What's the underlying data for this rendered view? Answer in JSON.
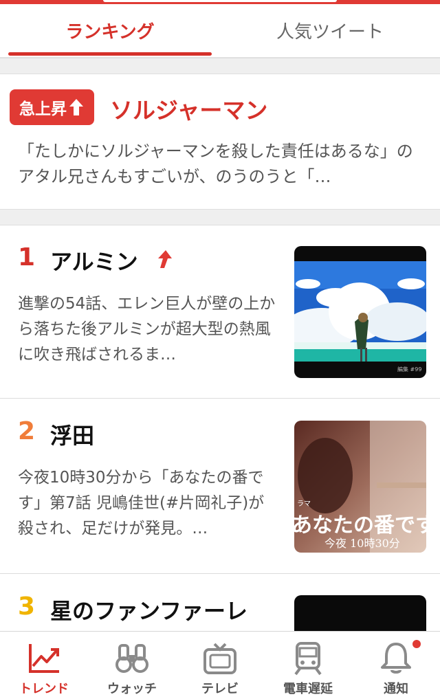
{
  "tabs": [
    {
      "label": "ランキング",
      "active": true
    },
    {
      "label": "人気ツイート",
      "active": false
    }
  ],
  "rising": {
    "badge": "急上昇",
    "title": "ソルジャーマン",
    "description": "「たしかにソルジャーマンを殺した責任はあるな」のアタル兄さんもすごいが、のうのうと「…"
  },
  "ranking": [
    {
      "rank": "1",
      "title": "アルミン",
      "trend": "up",
      "description": "進撃の54話、エレン巨人が壁の上から落ちた後アルミンが超大型の熱風に吹き飛ばされるま…",
      "thumb_icon": "anime-sky-thumbnail",
      "rank_color": "#d5312a"
    },
    {
      "rank": "2",
      "title": "浮田",
      "trend": "",
      "description": "今夜10時30分から「あなたの番です」第7話 児嶋佳世(#片岡礼子)が殺され、足だけが発見。…",
      "thumb_icon": "drama-thumbnail",
      "thumb_caption_small": "ラマ",
      "thumb_caption_big": "あなたの番です",
      "thumb_caption_time": "今夜 10時30分",
      "rank_color": "#f07d3a"
    },
    {
      "rank": "3",
      "title": "星のファンファーレ",
      "trend": "",
      "description": "",
      "thumb_icon": "black-thumbnail",
      "rank_color": "#f0b400"
    }
  ],
  "thumb1_caption": "編集 #99",
  "bottom_nav": [
    {
      "label": "トレンド",
      "icon": "trend-chart-icon",
      "active": true
    },
    {
      "label": "ウォッチ",
      "icon": "binoculars-icon",
      "active": false
    },
    {
      "label": "テレビ",
      "icon": "tv-icon",
      "active": false
    },
    {
      "label": "電車遅延",
      "icon": "train-icon",
      "active": false
    },
    {
      "label": "通知",
      "icon": "bell-icon",
      "active": false
    }
  ],
  "colors": {
    "accent": "#d5312a",
    "rank1": "#d5312a",
    "rank2": "#f07d3a",
    "rank3": "#f0b400"
  }
}
